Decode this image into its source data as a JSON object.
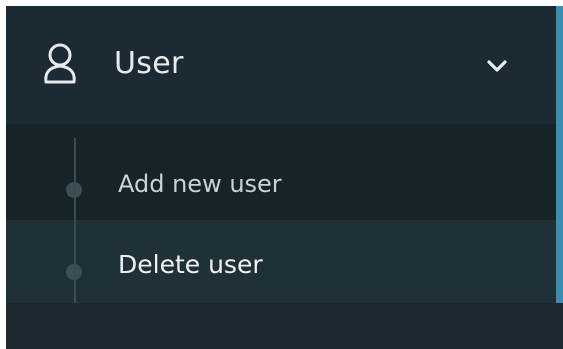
{
  "menu": {
    "section_label": "User",
    "section_icon": "user-icon",
    "toggle_icon": "chevron-down-icon",
    "items": [
      {
        "label": "Add new user",
        "state": "default"
      },
      {
        "label": "Delete user",
        "state": "hover"
      }
    ]
  },
  "colors": {
    "background": "#18262b",
    "header": "#1b2b31",
    "submenu": "#162428",
    "hover_row": "#1f3036",
    "accent": "#3a8fb0",
    "text": "#e6ecee"
  }
}
